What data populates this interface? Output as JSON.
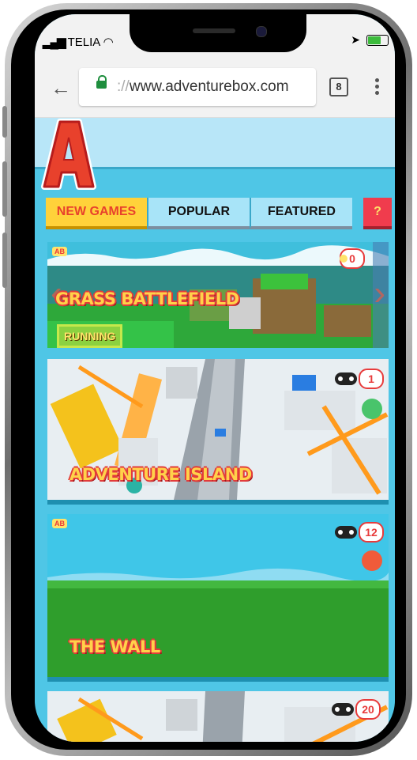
{
  "status_bar": {
    "carrier": "TELIA"
  },
  "browser": {
    "url_prefix": "://",
    "url_main": "www.adventurebox.com",
    "tab_count": "8"
  },
  "site": {
    "logo_letter": "A"
  },
  "nav": {
    "tabs": [
      "NEW GAMES",
      "POPULAR",
      "FEATURED"
    ],
    "help": "?"
  },
  "games": [
    {
      "title": "GRASS BATTLEFIELD",
      "players": "0",
      "status": "RUNNING"
    },
    {
      "title": "ADVENTURE ISLAND",
      "players": "1"
    },
    {
      "title": "THE WALL",
      "players": "12"
    },
    {
      "title": "",
      "players": "20"
    }
  ],
  "colors": {
    "accent_red": "#e83b3b",
    "accent_yellow": "#ffd23a",
    "sky": "#4fc6e6"
  }
}
